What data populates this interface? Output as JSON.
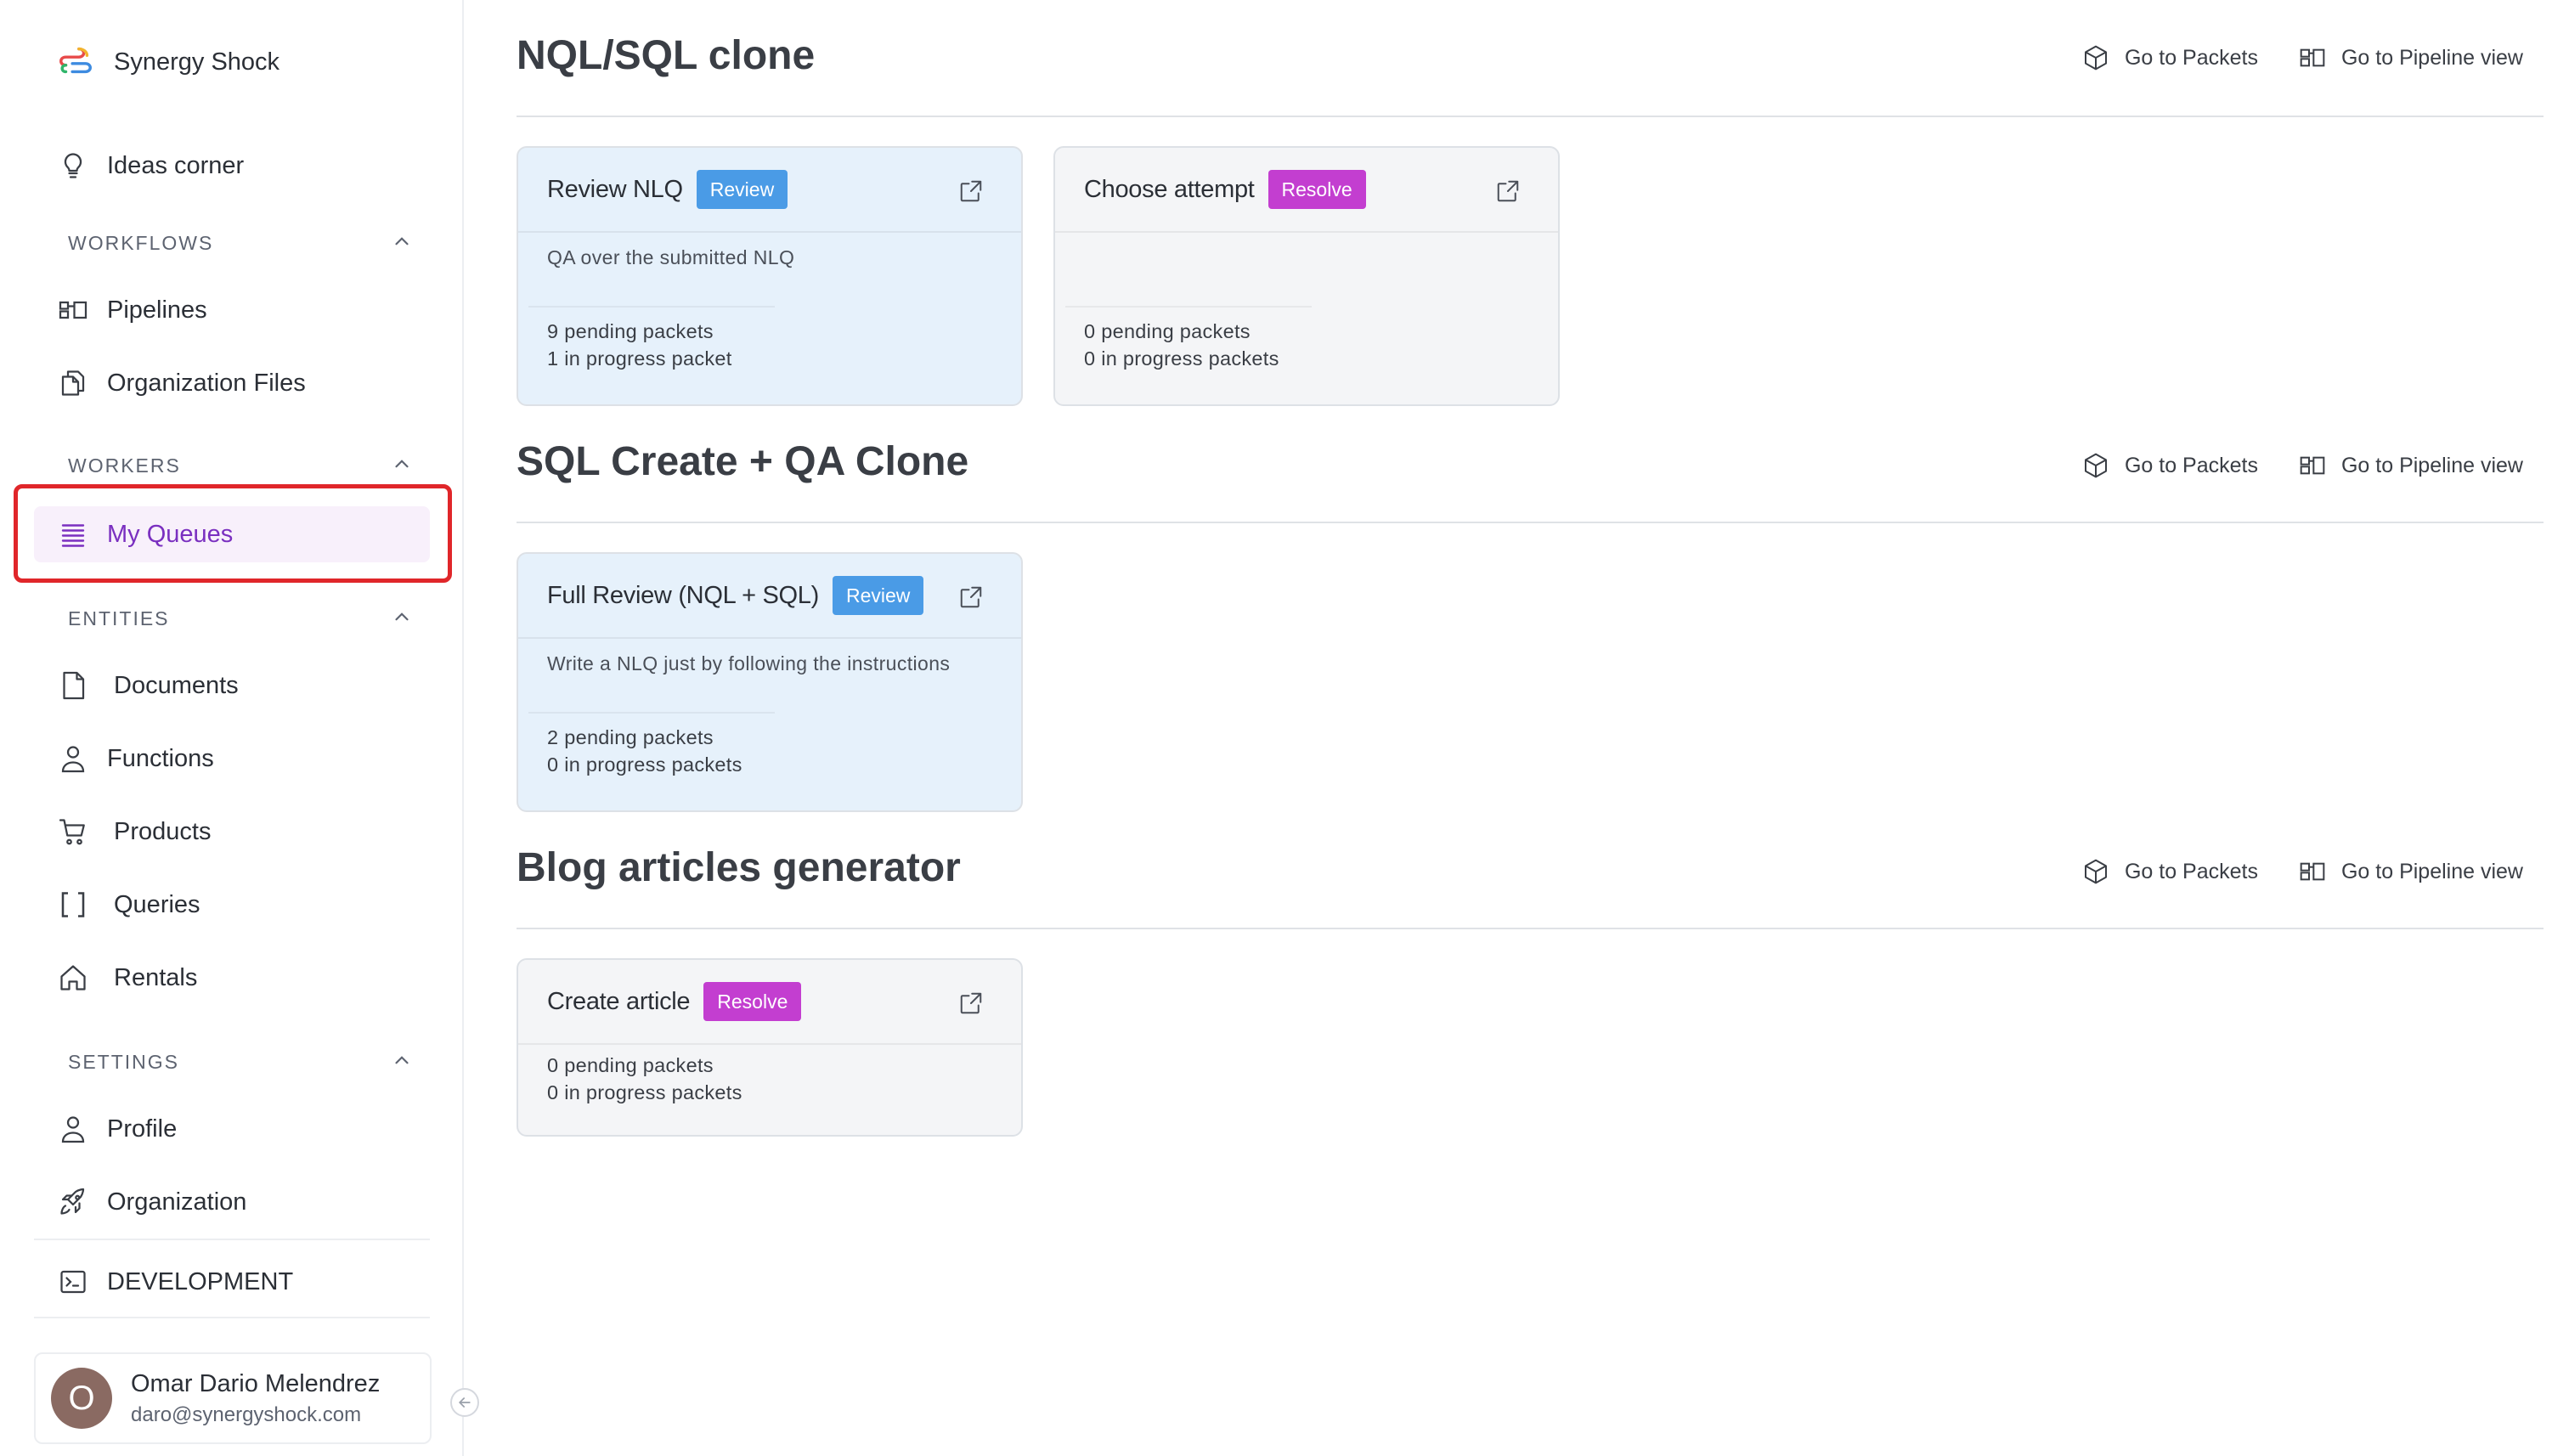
{
  "brand": {
    "name": "Synergy Shock"
  },
  "sidebar": {
    "ideas": {
      "label": "Ideas corner"
    },
    "sections": {
      "workflows": "WORKFLOWS",
      "workers": "WORKERS",
      "entities": "ENTITIES",
      "settings": "SETTINGS"
    },
    "workflows": [
      {
        "label": "Pipelines",
        "icon": "pipeline-icon"
      },
      {
        "label": "Organization Files",
        "icon": "files-icon"
      }
    ],
    "workers": [
      {
        "label": "My Queues",
        "icon": "queue-list-icon",
        "active": true
      }
    ],
    "entities": [
      {
        "label": "Documents",
        "icon": "document-icon"
      },
      {
        "label": "Functions",
        "icon": "person-icon"
      },
      {
        "label": "Products",
        "icon": "cart-icon"
      },
      {
        "label": "Queries",
        "icon": "brackets-icon"
      },
      {
        "label": "Rentals",
        "icon": "home-icon"
      }
    ],
    "settings": [
      {
        "label": "Profile",
        "icon": "person-icon"
      },
      {
        "label": "Organization",
        "icon": "rocket-icon"
      }
    ],
    "development": {
      "label": "DEVELOPMENT",
      "icon": "terminal-icon"
    },
    "user": {
      "initial": "O",
      "name": "Omar Dario Melendrez",
      "email": "daro@synergyshock.com"
    }
  },
  "actions": {
    "packets": "Go to Packets",
    "pipeline_view": "Go to Pipeline view"
  },
  "pipelines": [
    {
      "title": "NQL/SQL clone",
      "cards": [
        {
          "title": "Review NLQ",
          "badge": "Review",
          "description": "QA over the submitted NLQ",
          "pending": "9 pending packets",
          "in_progress": "1 in progress packet"
        },
        {
          "title": "Choose attempt",
          "badge": "Resolve",
          "description": "",
          "pending": "0 pending packets",
          "in_progress": "0 in progress packets"
        }
      ]
    },
    {
      "title": "SQL Create + QA Clone",
      "cards": [
        {
          "title": "Full Review (NQL + SQL)",
          "badge": "Review",
          "description": "Write a NLQ just by following the instructions",
          "pending": "2 pending packets",
          "in_progress": "0 in progress packets"
        }
      ]
    },
    {
      "title": "Blog articles generator",
      "cards": [
        {
          "title": "Create article",
          "badge": "Resolve",
          "description": "",
          "pending": "0 pending packets",
          "in_progress": "0 in progress packets"
        }
      ]
    }
  ],
  "colors": {
    "accent": "#7a2fc0",
    "review_badge": "#4a9be6",
    "resolve_badge": "#c33ed0",
    "highlight": "#e0262a"
  }
}
